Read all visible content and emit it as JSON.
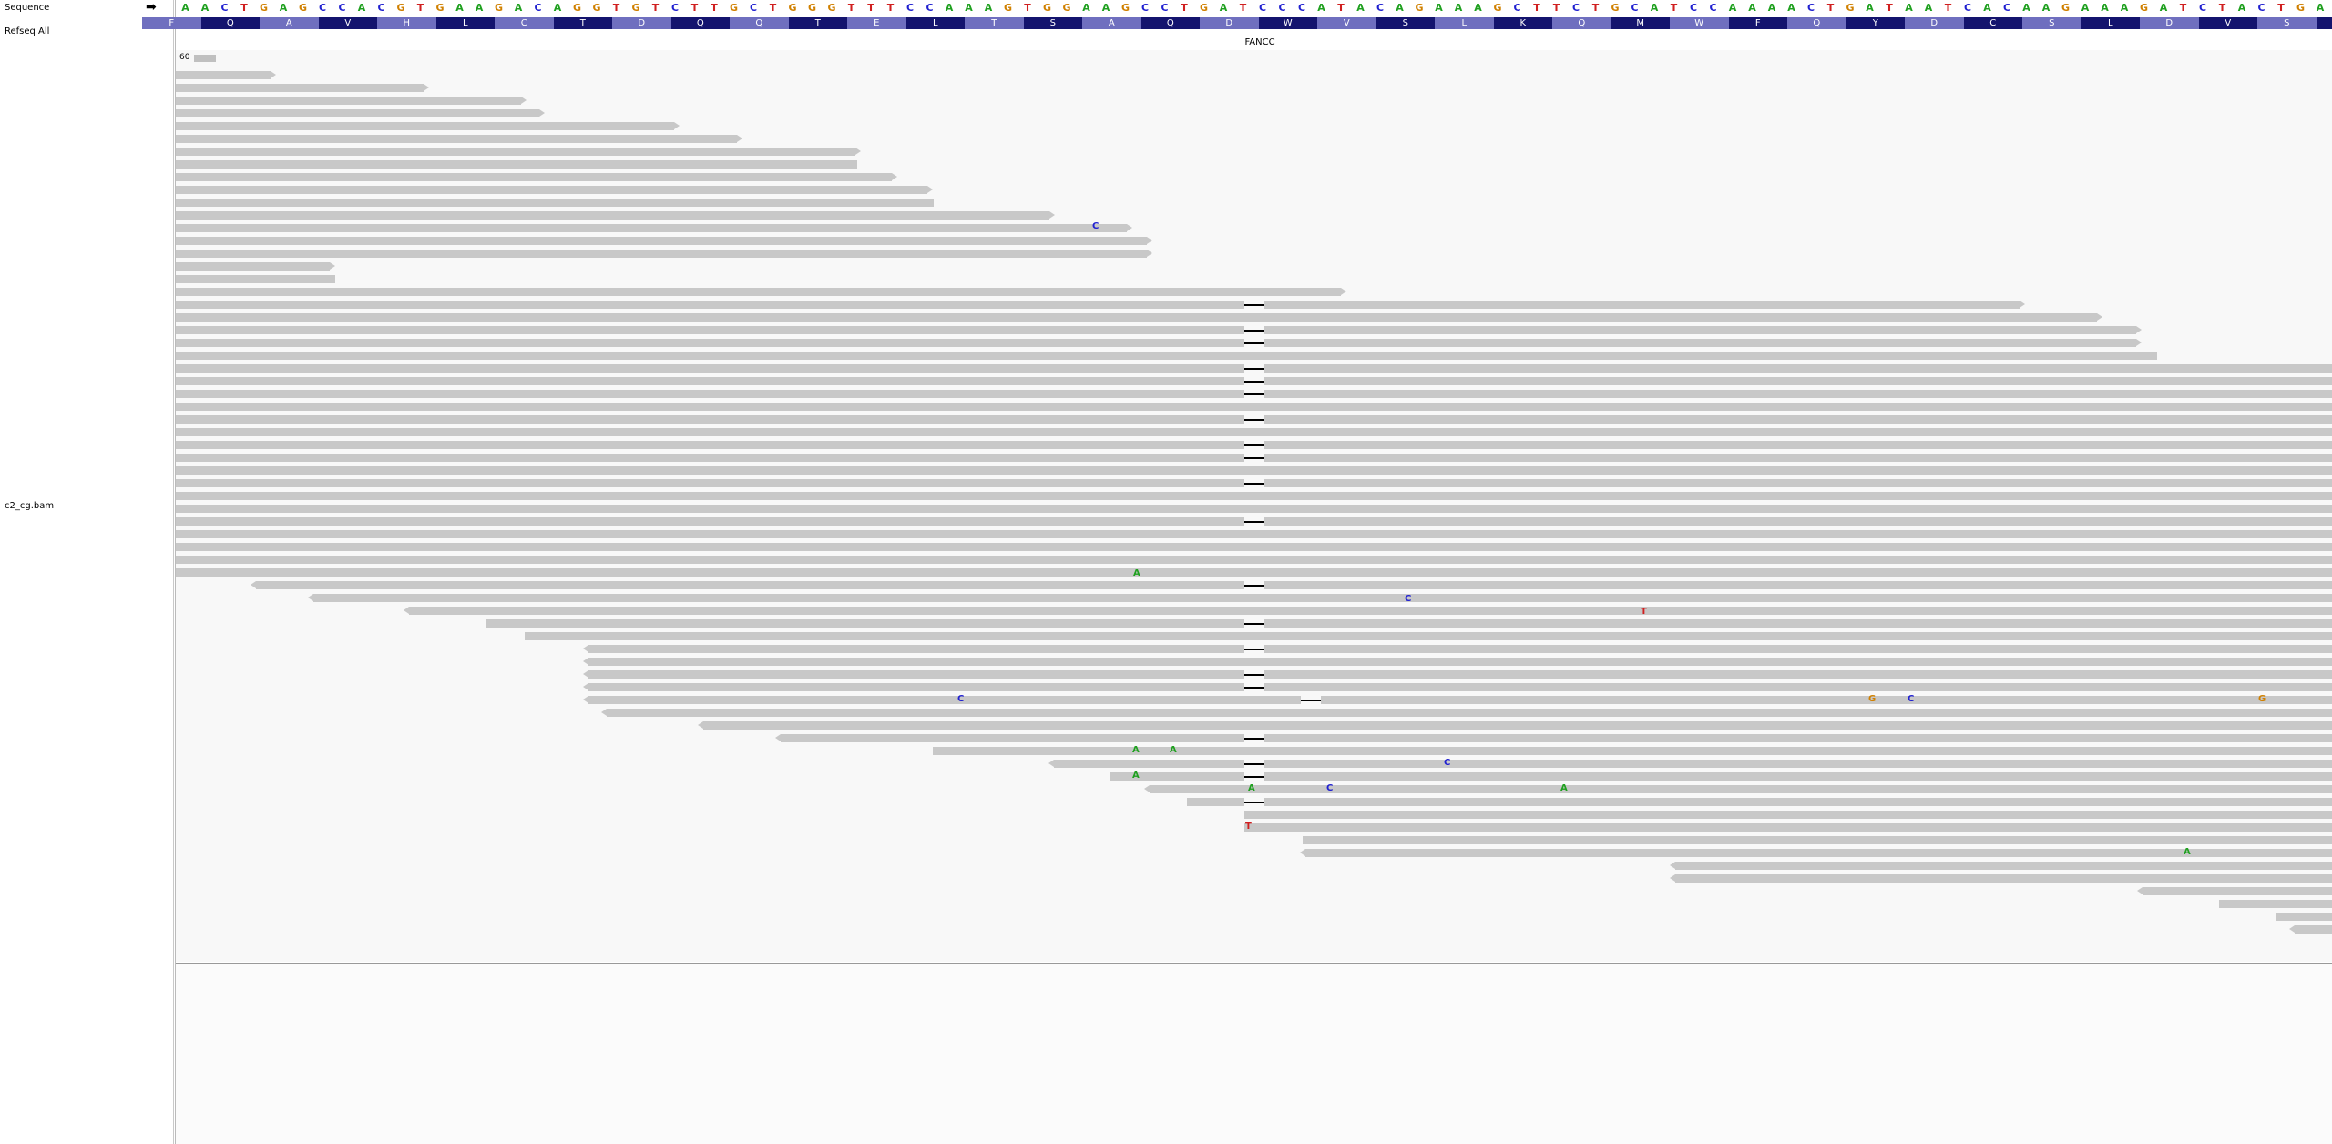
{
  "track_names": {
    "sequence": "Sequence",
    "refseq": "Refseq All",
    "bam": "c2_cg.bam"
  },
  "gene": {
    "name": "FANCC"
  },
  "coverage": {
    "label": "60"
  },
  "strand_icon": "right-arrow-icon",
  "sequence": "AACTGAGCCACGTGAAGACAGGTGTCTTGCTGGGTTTCCAAAGTGGAAGCCTGATCCCATACAGAAAGCTTCTGCATCCAAAACTGATAATCACAAGAAAGATCTACTGAA",
  "amino_acids": [
    "F",
    "Q",
    "A",
    "V",
    "H",
    "L",
    "C",
    "T",
    "D",
    "Q",
    "Q",
    "T",
    "E",
    "L",
    "T",
    "S",
    "A",
    "Q",
    "D",
    "W",
    "V",
    "S",
    "L",
    "K",
    "Q",
    "M",
    "W",
    "F",
    "Q",
    "Y",
    "D",
    "C",
    "S",
    "L",
    "D",
    "V",
    "S",
    ""
  ],
  "colors": {
    "A": "#1fa01f",
    "C": "#2020d0",
    "G": "#d08000",
    "T": "#d02020",
    "aa_light": "#6f6fbf",
    "aa_dark": "#14146e",
    "read": "#c8c8c8"
  }
}
